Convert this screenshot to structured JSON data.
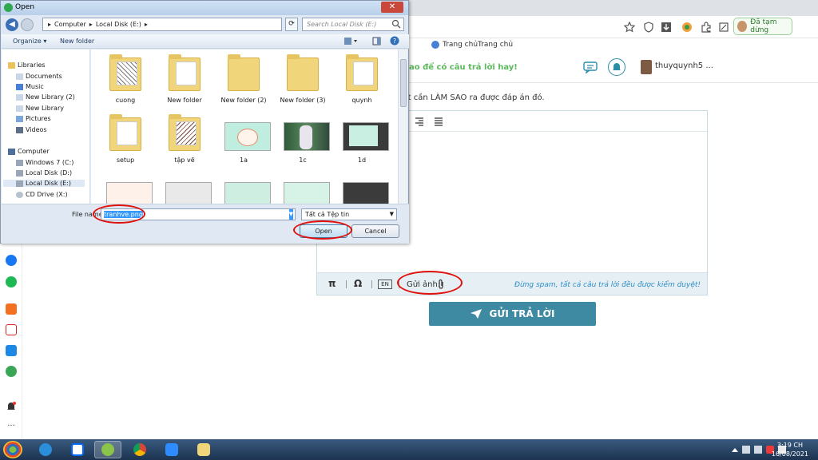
{
  "browser": {
    "paused_label": "Đã tạm dừng",
    "bookmark_label": "Trang chủTrang chủ"
  },
  "page": {
    "header_title": "ao để có câu trả lời hay!",
    "username": "thuyquynh5 ...",
    "hint_text": "hỏi rất cần LÀM SAO ra được đáp án đó.",
    "editor": {
      "pi_label": "π",
      "omega_label": "Ω",
      "en_label": "EN",
      "upload_label": "Gửi ảnh:",
      "spam_note": "Đừng spam, tất cả câu trả lời đều được kiểm duyệt!"
    },
    "submit_label": "GỬI TRẢ LỜI"
  },
  "dialog": {
    "title": "Open",
    "close_label": "✕",
    "address": [
      "Computer",
      "Local Disk (E:)"
    ],
    "search_placeholder": "Search Local Disk (E:)",
    "organize_label": "Organize ▾",
    "new_folder_label": "New folder",
    "nav_items": [
      {
        "label": "Libraries",
        "icon": "libraries-icon"
      },
      {
        "label": "Documents",
        "icon": "documents-icon"
      },
      {
        "label": "Music",
        "icon": "music-icon"
      },
      {
        "label": "New Library (2)",
        "icon": "library-icon"
      },
      {
        "label": "New Library",
        "icon": "library-icon"
      },
      {
        "label": "Pictures",
        "icon": "pictures-icon"
      },
      {
        "label": "Videos",
        "icon": "videos-icon"
      },
      {
        "label": "Computer",
        "icon": "computer-icon"
      },
      {
        "label": "Windows 7 (C:)",
        "icon": "drive-icon"
      },
      {
        "label": "Local Disk (D:)",
        "icon": "drive-icon"
      },
      {
        "label": "Local Disk (E:)",
        "icon": "drive-icon"
      },
      {
        "label": "CD Drive (X:)",
        "icon": "cd-drive-icon"
      }
    ],
    "files": [
      {
        "name": "cuong",
        "kind": "folder"
      },
      {
        "name": "New folder",
        "kind": "folder"
      },
      {
        "name": "New folder (2)",
        "kind": "folder"
      },
      {
        "name": "New folder (3)",
        "kind": "folder"
      },
      {
        "name": "quynh",
        "kind": "folder"
      },
      {
        "name": "setup",
        "kind": "folder"
      },
      {
        "name": "tập vẽ",
        "kind": "folder"
      },
      {
        "name": "1a",
        "kind": "image"
      },
      {
        "name": "1c",
        "kind": "image"
      },
      {
        "name": "1d",
        "kind": "image"
      }
    ],
    "file_name_label": "File name:",
    "file_name_value": "tranhve.png",
    "file_type_value": "Tất cả Tệp tin",
    "open_label": "Open",
    "cancel_label": "Cancel"
  },
  "taskbar": {
    "time": "3:19 CH",
    "date": "16/08/2021"
  },
  "colors": {
    "accent": "#3e8aa2",
    "annotation_red": "#e0110b",
    "green_title": "#5cb85c"
  }
}
